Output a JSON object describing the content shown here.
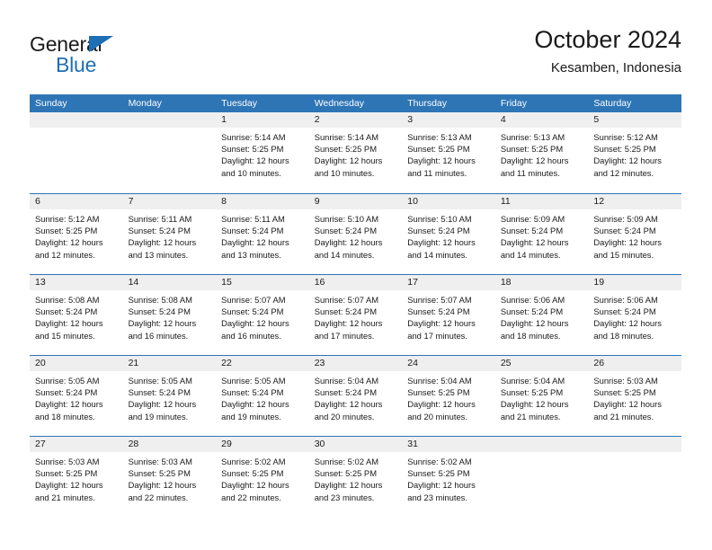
{
  "brand": {
    "name_top": "General",
    "name_bottom": "Blue",
    "accent_color": "#2e75b6",
    "triangle_icon": "triangle-icon"
  },
  "header": {
    "title": "October 2024",
    "location": "Kesamben, Indonesia"
  },
  "calendar": {
    "header_bg": "#2e75b6",
    "daynum_bg": "#efefef",
    "weekdays": [
      "Sunday",
      "Monday",
      "Tuesday",
      "Wednesday",
      "Thursday",
      "Friday",
      "Saturday"
    ],
    "weeks": [
      [
        {
          "day": "",
          "lines": []
        },
        {
          "day": "",
          "lines": []
        },
        {
          "day": "1",
          "lines": [
            "Sunrise: 5:14 AM",
            "Sunset: 5:25 PM",
            "Daylight: 12 hours",
            "and 10 minutes."
          ]
        },
        {
          "day": "2",
          "lines": [
            "Sunrise: 5:14 AM",
            "Sunset: 5:25 PM",
            "Daylight: 12 hours",
            "and 10 minutes."
          ]
        },
        {
          "day": "3",
          "lines": [
            "Sunrise: 5:13 AM",
            "Sunset: 5:25 PM",
            "Daylight: 12 hours",
            "and 11 minutes."
          ]
        },
        {
          "day": "4",
          "lines": [
            "Sunrise: 5:13 AM",
            "Sunset: 5:25 PM",
            "Daylight: 12 hours",
            "and 11 minutes."
          ]
        },
        {
          "day": "5",
          "lines": [
            "Sunrise: 5:12 AM",
            "Sunset: 5:25 PM",
            "Daylight: 12 hours",
            "and 12 minutes."
          ]
        }
      ],
      [
        {
          "day": "6",
          "lines": [
            "Sunrise: 5:12 AM",
            "Sunset: 5:25 PM",
            "Daylight: 12 hours",
            "and 12 minutes."
          ]
        },
        {
          "day": "7",
          "lines": [
            "Sunrise: 5:11 AM",
            "Sunset: 5:24 PM",
            "Daylight: 12 hours",
            "and 13 minutes."
          ]
        },
        {
          "day": "8",
          "lines": [
            "Sunrise: 5:11 AM",
            "Sunset: 5:24 PM",
            "Daylight: 12 hours",
            "and 13 minutes."
          ]
        },
        {
          "day": "9",
          "lines": [
            "Sunrise: 5:10 AM",
            "Sunset: 5:24 PM",
            "Daylight: 12 hours",
            "and 14 minutes."
          ]
        },
        {
          "day": "10",
          "lines": [
            "Sunrise: 5:10 AM",
            "Sunset: 5:24 PM",
            "Daylight: 12 hours",
            "and 14 minutes."
          ]
        },
        {
          "day": "11",
          "lines": [
            "Sunrise: 5:09 AM",
            "Sunset: 5:24 PM",
            "Daylight: 12 hours",
            "and 14 minutes."
          ]
        },
        {
          "day": "12",
          "lines": [
            "Sunrise: 5:09 AM",
            "Sunset: 5:24 PM",
            "Daylight: 12 hours",
            "and 15 minutes."
          ]
        }
      ],
      [
        {
          "day": "13",
          "lines": [
            "Sunrise: 5:08 AM",
            "Sunset: 5:24 PM",
            "Daylight: 12 hours",
            "and 15 minutes."
          ]
        },
        {
          "day": "14",
          "lines": [
            "Sunrise: 5:08 AM",
            "Sunset: 5:24 PM",
            "Daylight: 12 hours",
            "and 16 minutes."
          ]
        },
        {
          "day": "15",
          "lines": [
            "Sunrise: 5:07 AM",
            "Sunset: 5:24 PM",
            "Daylight: 12 hours",
            "and 16 minutes."
          ]
        },
        {
          "day": "16",
          "lines": [
            "Sunrise: 5:07 AM",
            "Sunset: 5:24 PM",
            "Daylight: 12 hours",
            "and 17 minutes."
          ]
        },
        {
          "day": "17",
          "lines": [
            "Sunrise: 5:07 AM",
            "Sunset: 5:24 PM",
            "Daylight: 12 hours",
            "and 17 minutes."
          ]
        },
        {
          "day": "18",
          "lines": [
            "Sunrise: 5:06 AM",
            "Sunset: 5:24 PM",
            "Daylight: 12 hours",
            "and 18 minutes."
          ]
        },
        {
          "day": "19",
          "lines": [
            "Sunrise: 5:06 AM",
            "Sunset: 5:24 PM",
            "Daylight: 12 hours",
            "and 18 minutes."
          ]
        }
      ],
      [
        {
          "day": "20",
          "lines": [
            "Sunrise: 5:05 AM",
            "Sunset: 5:24 PM",
            "Daylight: 12 hours",
            "and 18 minutes."
          ]
        },
        {
          "day": "21",
          "lines": [
            "Sunrise: 5:05 AM",
            "Sunset: 5:24 PM",
            "Daylight: 12 hours",
            "and 19 minutes."
          ]
        },
        {
          "day": "22",
          "lines": [
            "Sunrise: 5:05 AM",
            "Sunset: 5:24 PM",
            "Daylight: 12 hours",
            "and 19 minutes."
          ]
        },
        {
          "day": "23",
          "lines": [
            "Sunrise: 5:04 AM",
            "Sunset: 5:24 PM",
            "Daylight: 12 hours",
            "and 20 minutes."
          ]
        },
        {
          "day": "24",
          "lines": [
            "Sunrise: 5:04 AM",
            "Sunset: 5:25 PM",
            "Daylight: 12 hours",
            "and 20 minutes."
          ]
        },
        {
          "day": "25",
          "lines": [
            "Sunrise: 5:04 AM",
            "Sunset: 5:25 PM",
            "Daylight: 12 hours",
            "and 21 minutes."
          ]
        },
        {
          "day": "26",
          "lines": [
            "Sunrise: 5:03 AM",
            "Sunset: 5:25 PM",
            "Daylight: 12 hours",
            "and 21 minutes."
          ]
        }
      ],
      [
        {
          "day": "27",
          "lines": [
            "Sunrise: 5:03 AM",
            "Sunset: 5:25 PM",
            "Daylight: 12 hours",
            "and 21 minutes."
          ]
        },
        {
          "day": "28",
          "lines": [
            "Sunrise: 5:03 AM",
            "Sunset: 5:25 PM",
            "Daylight: 12 hours",
            "and 22 minutes."
          ]
        },
        {
          "day": "29",
          "lines": [
            "Sunrise: 5:02 AM",
            "Sunset: 5:25 PM",
            "Daylight: 12 hours",
            "and 22 minutes."
          ]
        },
        {
          "day": "30",
          "lines": [
            "Sunrise: 5:02 AM",
            "Sunset: 5:25 PM",
            "Daylight: 12 hours",
            "and 23 minutes."
          ]
        },
        {
          "day": "31",
          "lines": [
            "Sunrise: 5:02 AM",
            "Sunset: 5:25 PM",
            "Daylight: 12 hours",
            "and 23 minutes."
          ]
        },
        {
          "day": "",
          "lines": []
        },
        {
          "day": "",
          "lines": []
        }
      ]
    ]
  }
}
